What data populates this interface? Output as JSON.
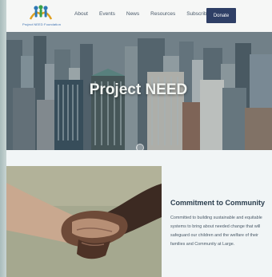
{
  "header": {
    "logo_text": "Project NEED Foundation",
    "nav": [
      "About",
      "Events",
      "News",
      "Resources",
      "Subscribe"
    ],
    "donate_label": "Donate"
  },
  "hero": {
    "title": "Project NEED"
  },
  "feature": {
    "title": "Commitment to Community",
    "body": "Committed to building sustainable and equitable systems to bring about needed change that will safeguard our children and the welfare of their families and Community at Large."
  },
  "colors": {
    "brand_navy": "#2f3f66",
    "heading": "#2a3d4d",
    "body_text": "#4a5a68"
  }
}
